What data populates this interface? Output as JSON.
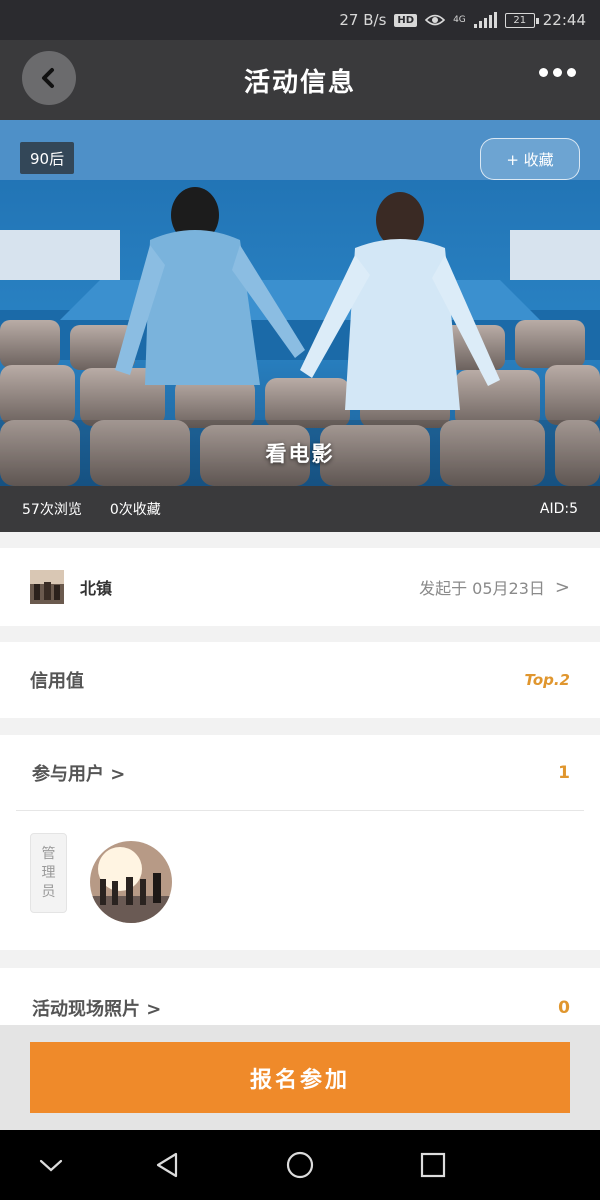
{
  "status_bar": {
    "speed": "27 B/s",
    "hd": "HD",
    "network": "4G",
    "battery": "21",
    "time": "22:44"
  },
  "nav": {
    "title": "活动信息"
  },
  "hero": {
    "tag": "90后",
    "favorite_label": "+ 收藏",
    "activity_title": "看电影"
  },
  "stats": {
    "views": "57次浏览",
    "favorites": "0次收藏",
    "aid": "AID:5"
  },
  "organizer": {
    "name": "北镇",
    "date": "发起于 05月23日",
    "chevron": ">"
  },
  "credit": {
    "label": "信用值",
    "value": "Top.2"
  },
  "participants": {
    "label": "参与用户 >",
    "count": "1",
    "admin_badge": [
      "管",
      "理",
      "员"
    ]
  },
  "photos": {
    "label": "活动现场照片 >",
    "count": "0"
  },
  "action": {
    "signup_label": "报名参加"
  },
  "icons": {
    "back": "chevron-left-icon",
    "more": "more-horizontal-icon",
    "eye": "eye-icon",
    "signal": "signal-icon",
    "battery": "battery-icon",
    "sys_down": "chevron-down-icon",
    "sys_back": "triangle-back-icon",
    "sys_home": "circle-home-icon",
    "sys_recent": "square-recent-icon"
  },
  "colors": {
    "accent": "#ef8a2a",
    "highlight_text": "#e0962e",
    "bar_dark": "#3a3a3c"
  }
}
